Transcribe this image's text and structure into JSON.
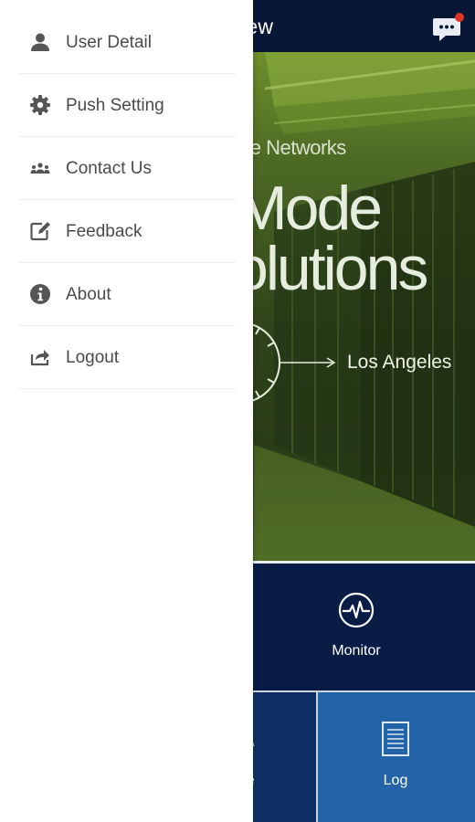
{
  "app": {
    "title": "oudView",
    "hero": {
      "company": "ne Networks",
      "line1": "Mode",
      "line2": "olutions",
      "city": "Los Angeles"
    },
    "tiles": {
      "monitor": "Monitor",
      "log": "Log",
      "partial": "se"
    }
  },
  "drawer": {
    "items": [
      {
        "label": "User Detail",
        "icon": "user-icon"
      },
      {
        "label": "Push Setting",
        "icon": "gear-icon"
      },
      {
        "label": "Contact Us",
        "icon": "contacts-icon"
      },
      {
        "label": "Feedback",
        "icon": "edit-icon"
      },
      {
        "label": "About",
        "icon": "info-icon"
      },
      {
        "label": "Logout",
        "icon": "logout-icon"
      }
    ]
  },
  "colors": {
    "header": "#091737",
    "tile_dark": "#091c46",
    "tile_mid": "#0d2f66",
    "tile_light": "#2364a8",
    "hero_green": "#4f6c25",
    "notification": "#e0342b",
    "menu_text": "#4a4a4a"
  }
}
